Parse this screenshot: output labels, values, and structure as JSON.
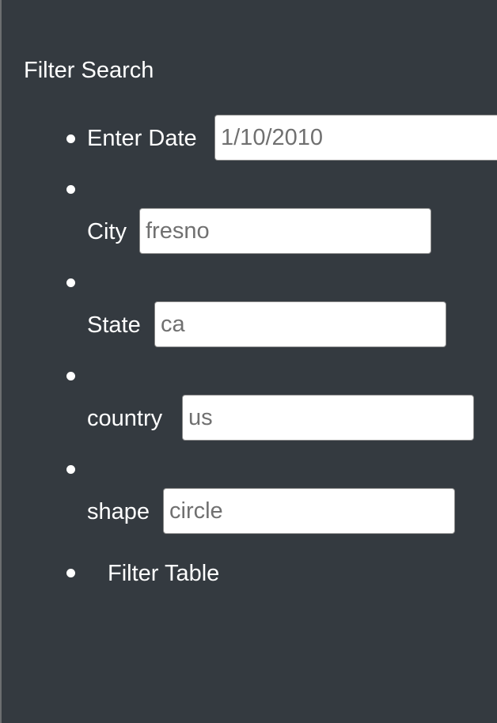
{
  "filter": {
    "title": "Filter Search",
    "fields": {
      "date": {
        "label": "Enter Date",
        "value": "1/10/2010"
      },
      "city": {
        "label": "City",
        "value": "fresno"
      },
      "state": {
        "label": "State",
        "value": "ca"
      },
      "country": {
        "label": "country",
        "value": "us"
      },
      "shape": {
        "label": "shape",
        "value": "circle"
      }
    },
    "button_label": "Filter Table"
  }
}
